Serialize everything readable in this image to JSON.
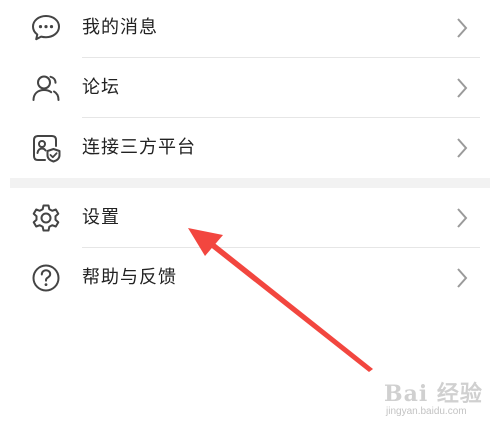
{
  "menu": {
    "group1": [
      {
        "label": "我的消息",
        "icon": "message-icon"
      },
      {
        "label": "论坛",
        "icon": "user-icon"
      },
      {
        "label": "连接三方平台",
        "icon": "shield-card-icon"
      }
    ],
    "group2": [
      {
        "label": "设置",
        "icon": "gear-icon"
      },
      {
        "label": "帮助与反馈",
        "icon": "help-icon"
      }
    ]
  },
  "annotation": {
    "arrow_color": "#f2463f",
    "points_to": "设置"
  },
  "watermark": {
    "brand": "Bai 经验",
    "url": "jingyan.baidu.com"
  },
  "colors": {
    "icon": "#444444",
    "chevron": "#9a9a9a",
    "divider": "#e6e6e6",
    "gap": "#f2f2f2"
  }
}
